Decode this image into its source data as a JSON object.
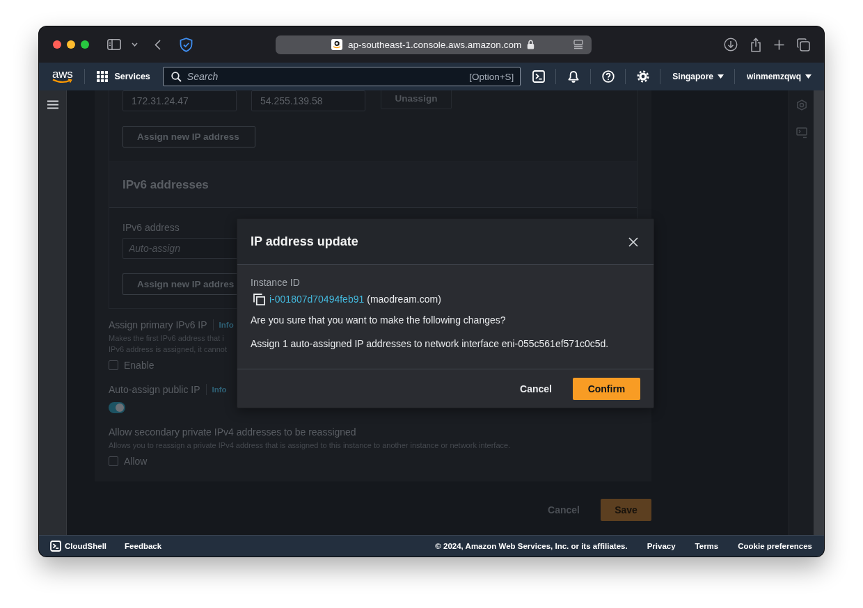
{
  "browser": {
    "url": "ap-southeast-1.console.aws.amazon.com"
  },
  "top_nav": {
    "logo": "aws",
    "services": "Services",
    "search": {
      "placeholder": "Search",
      "shortcut": "[Option+S]"
    },
    "region": "Singapore",
    "account": "winmemzqwq"
  },
  "form": {
    "ipv4": {
      "addresses": [
        "172.31.24.47",
        "54.255.139.58"
      ],
      "unassign": {
        "label": "Unassign",
        "disabled": true
      },
      "assign_button": "Assign new IP address"
    },
    "ipv6": {
      "heading": "IPv6 addresses",
      "field_label": "IPv6 address",
      "placeholder": "Auto-assign",
      "assign_button": "Assign new IP addres"
    },
    "settings": [
      {
        "kind": "checkbox",
        "label": "Assign primary IPv6 IP",
        "info": "Info",
        "description_lines": [
          "Makes the first IPv6 address that i",
          "IPv6 address is assigned, it cannot"
        ],
        "option": "Enable",
        "checked": false
      },
      {
        "kind": "toggle",
        "label": "Auto-assign public IP",
        "info": "Info",
        "on": true
      },
      {
        "kind": "checkbox",
        "label": "Allow secondary private IPv4 addresses to be reassigned",
        "description_lines": [
          "Allows you to reassign a private IPv4 address that is assigned to this instance to another instance or network interface."
        ],
        "option": "Allow",
        "checked": false
      }
    ],
    "actions": {
      "cancel": "Cancel",
      "save": "Save"
    }
  },
  "modal": {
    "title": "IP address update",
    "instance_label": "Instance ID",
    "instance_id": "i-001807d70494feb91",
    "instance_name": "(maodream.com)",
    "question": "Are you sure that you want to make the following changes?",
    "change": "Assign 1 auto-assigned IP addresses to network interface eni-055c561ef571c0c5d.",
    "cancel": "Cancel",
    "confirm": "Confirm"
  },
  "footer": {
    "cloudshell": "CloudShell",
    "feedback": "Feedback",
    "copyright": "© 2024, Amazon Web Services, Inc. or its affiliates.",
    "links": [
      "Privacy",
      "Terms",
      "Cookie preferences"
    ]
  }
}
